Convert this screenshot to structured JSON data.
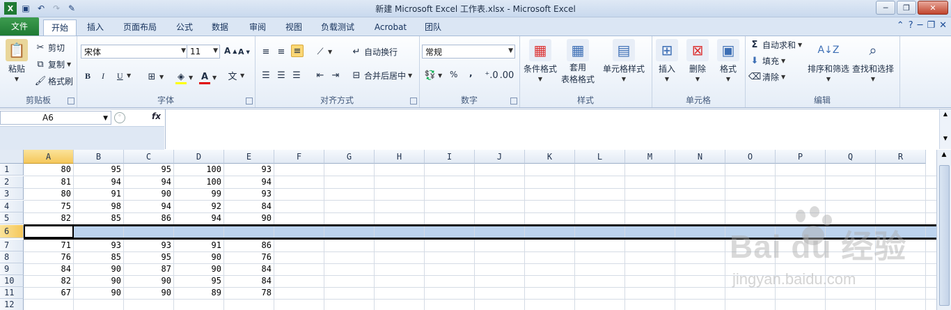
{
  "window": {
    "title": "新建 Microsoft Excel 工作表.xlsx  -  Microsoft Excel"
  },
  "tabs": [
    {
      "label": "文件"
    },
    {
      "label": "开始"
    },
    {
      "label": "插入"
    },
    {
      "label": "页面布局"
    },
    {
      "label": "公式"
    },
    {
      "label": "数据"
    },
    {
      "label": "审阅"
    },
    {
      "label": "视图"
    },
    {
      "label": "负载测试"
    },
    {
      "label": "Acrobat"
    },
    {
      "label": "团队"
    }
  ],
  "ribbon": {
    "clipboard": {
      "label": "剪贴板",
      "paste": "粘贴",
      "cut": "剪切",
      "copy": "复制",
      "format_painter": "格式刷"
    },
    "font": {
      "label": "字体",
      "font_name": "宋体",
      "font_size": "11",
      "bold": "B",
      "italic": "I",
      "underline": "U"
    },
    "alignment": {
      "label": "对齐方式",
      "wrap": "自动换行",
      "merge": "合并后居中"
    },
    "number": {
      "label": "数字",
      "format": "常规",
      "percent": "%",
      "comma": ","
    },
    "styles": {
      "label": "样式",
      "conditional": "条件格式",
      "table_line1": "套用",
      "table_line2": "表格格式",
      "cell_styles": "单元格样式"
    },
    "cells": {
      "label": "单元格",
      "insert": "插入",
      "delete": "删除",
      "format": "格式"
    },
    "editing": {
      "label": "编辑",
      "autosum": "自动求和",
      "fill": "填充",
      "clear": "清除",
      "sort": "排序和筛选",
      "find": "查找和选择"
    }
  },
  "formula_bar": {
    "name_box": "A6",
    "fx": "fx",
    "value": ""
  },
  "sheet": {
    "columns": [
      "A",
      "B",
      "C",
      "D",
      "E",
      "F",
      "G",
      "H",
      "I",
      "J",
      "K",
      "L",
      "M",
      "N",
      "O",
      "P",
      "Q",
      "R"
    ],
    "selected_column": "A",
    "selected_row": "6",
    "rows": [
      {
        "num": "1",
        "cells": [
          "80",
          "95",
          "95",
          "100",
          "93"
        ]
      },
      {
        "num": "2",
        "cells": [
          "81",
          "94",
          "94",
          "100",
          "94"
        ]
      },
      {
        "num": "3",
        "cells": [
          "80",
          "91",
          "90",
          "99",
          "93"
        ]
      },
      {
        "num": "4",
        "cells": [
          "75",
          "98",
          "94",
          "92",
          "84"
        ]
      },
      {
        "num": "5",
        "cells": [
          "82",
          "85",
          "86",
          "94",
          "90"
        ]
      },
      {
        "num": "6",
        "cells": [
          "",
          "",
          "",
          "",
          ""
        ]
      },
      {
        "num": "7",
        "cells": [
          "71",
          "93",
          "93",
          "91",
          "86"
        ]
      },
      {
        "num": "8",
        "cells": [
          "76",
          "85",
          "95",
          "90",
          "76"
        ]
      },
      {
        "num": "9",
        "cells": [
          "84",
          "90",
          "87",
          "90",
          "84"
        ]
      },
      {
        "num": "10",
        "cells": [
          "82",
          "90",
          "90",
          "95",
          "84"
        ]
      },
      {
        "num": "11",
        "cells": [
          "67",
          "90",
          "90",
          "89",
          "78"
        ]
      },
      {
        "num": "12",
        "cells": [
          "",
          "",
          "",
          "",
          ""
        ]
      }
    ]
  },
  "watermark": {
    "logo": "Bai du 经验",
    "url": "jingyan.baidu.com"
  },
  "colors": {
    "file_tab": "#2a8a3f",
    "selected_header": "#f5c75a",
    "selected_row": "#bcd3ee"
  }
}
